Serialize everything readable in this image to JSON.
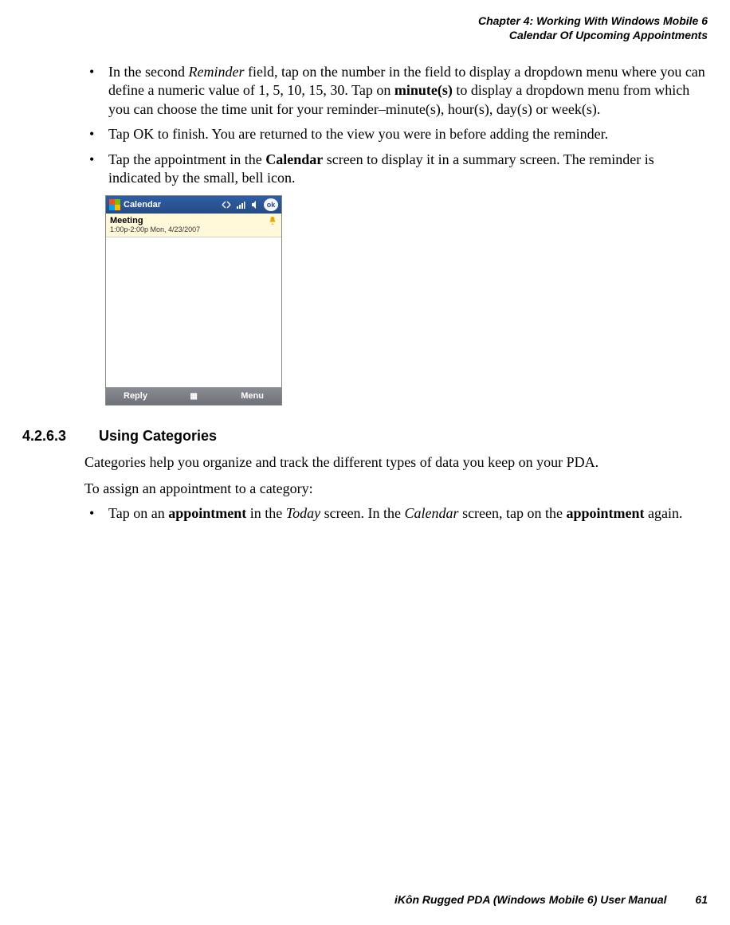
{
  "header": {
    "line1": "Chapter 4: Working With Windows Mobile 6",
    "line2": "Calendar Of Upcoming Appointments"
  },
  "bullets_top": {
    "b1_pre": "In the second ",
    "b1_em1": "Reminder",
    "b1_mid": " field, tap on the number in the field to display a dropdown menu where you can define a numeric value of 1, 5, 10, 15, 30. Tap on ",
    "b1_bold": "minute(s)",
    "b1_post": " to display a dropdown menu from which you can choose the time unit for your reminder–minute(s), hour(s), day(s) or week(s).",
    "b2": "Tap OK to finish. You are returned to the view you were in before adding the reminder.",
    "b3_pre": "Tap the appointment in the ",
    "b3_bold": "Calendar",
    "b3_post": " screen to display it in a summary screen. The reminder is indicated by the small, bell icon."
  },
  "screenshot": {
    "app_title": "Calendar",
    "ok_label": "ok",
    "appointment_title": "Meeting",
    "appointment_time": "1:00p-2:00p Mon, 4/23/2007",
    "softkey_left": "Reply",
    "softkey_right": "Menu",
    "kbd_glyph": "▦"
  },
  "section": {
    "number": "4.2.6.3",
    "title": "Using Categories",
    "p1": "Categories help you organize and track the different types of data you keep on your PDA.",
    "p2": "To assign an appointment to a category:",
    "bullet_pre": "Tap on an ",
    "bullet_b1": "appointment",
    "bullet_mid1": " in the ",
    "bullet_em1": "Today",
    "bullet_mid2": " screen. In the ",
    "bullet_em2": "Calendar",
    "bullet_mid3": " screen, tap on the ",
    "bullet_b2": "appointment",
    "bullet_post": " again."
  },
  "footer": {
    "text": "iKôn Rugged PDA (Windows Mobile 6) User Manual",
    "page": "61"
  }
}
